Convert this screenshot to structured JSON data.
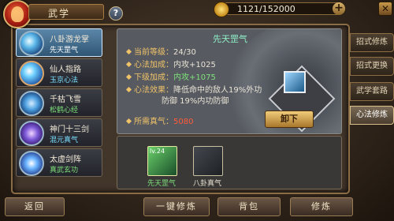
{
  "header": {
    "title": "武学",
    "help": "?",
    "money": "1121/152000",
    "plus": "+",
    "close": "✕"
  },
  "skills": [
    {
      "name": "八卦游龙掌",
      "sub": "先天罡气",
      "sub_color": "white",
      "badge": ""
    },
    {
      "name": "仙人指路",
      "sub": "玉京心法",
      "sub_color": "cyan",
      "badge": ""
    },
    {
      "name": "千枯飞雪",
      "sub": "松鹤心经",
      "sub_color": "green",
      "badge": ""
    },
    {
      "name": "神门十三剑",
      "sub": "混元真气",
      "sub_color": "cyan",
      "badge": ""
    },
    {
      "name": "太虚剑阵",
      "sub": "真武玄功",
      "sub_color": "green",
      "badge": ""
    }
  ],
  "detail": {
    "title": "先天罡气",
    "level_label": "当前等级：",
    "level_value": "24/30",
    "effect_label": "心法加成：",
    "effect_value": "内攻+1025",
    "next_label": "下级加成：",
    "next_value": "内攻+1075",
    "skill_effect_label": "心法效果：",
    "skill_effect_line1": "降低命中的敌人19%外功",
    "skill_effect_line2": "防御 19%内功防御",
    "cost_label": "所需真气：",
    "cost_value": "5080",
    "unload": "卸下"
  },
  "inventory": [
    {
      "level": "lv.24",
      "label": "先天罡气"
    },
    {
      "level": "",
      "label": "八卦真气"
    }
  ],
  "tabs": [
    "招式修炼",
    "招式更换",
    "武学套路",
    "心法修炼"
  ],
  "bottom": {
    "back": "返回",
    "auto": "一键修炼",
    "bag": "背包",
    "train": "修炼"
  }
}
